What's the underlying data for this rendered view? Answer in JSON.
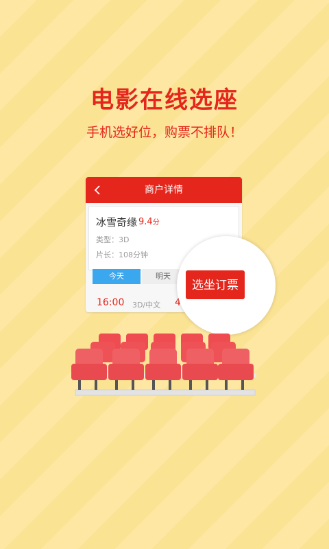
{
  "promo": {
    "headline": "电影在线选座",
    "subline": "手机选好位，购票不排队！"
  },
  "card": {
    "title": "商户详情",
    "movie": {
      "name": "冰雪奇缘",
      "score": "9.4",
      "score_unit": "分",
      "type": "类型：3D",
      "length": "片长：108分钟"
    },
    "tabs": [
      "今天",
      "明天"
    ],
    "showtime": {
      "time": "16:00",
      "format": "3D/中文",
      "price": "4"
    }
  },
  "cta": {
    "label": "选坐订票"
  },
  "colors": {
    "accent": "#e4261c",
    "tab_active": "#3aa7ee",
    "background": "#fde7a2",
    "seat": "#ef5f62"
  }
}
